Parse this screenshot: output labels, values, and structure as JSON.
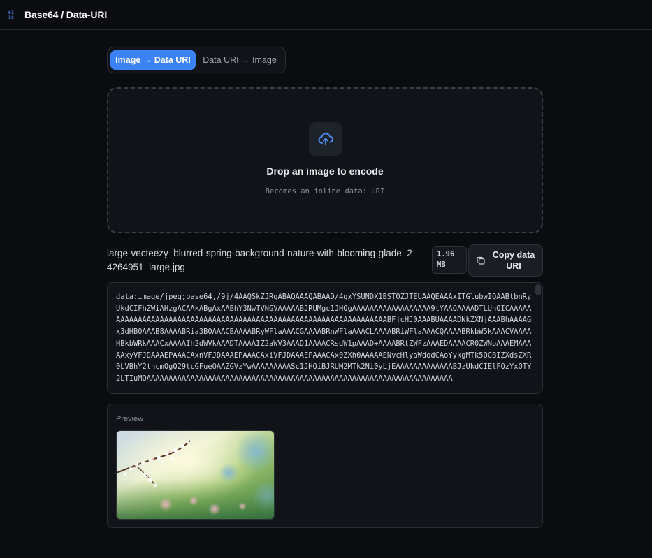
{
  "app": {
    "title": "Base64 / Data-URI",
    "icon": "binary-icon"
  },
  "tabs": [
    {
      "label": "Image → Data URI",
      "active": true
    },
    {
      "label": "Data URI → Image",
      "active": false
    }
  ],
  "dropzone": {
    "icon": "upload-cloud-icon",
    "title": "Drop an image to encode",
    "subtitle": "Becomes an inline data: URI"
  },
  "file": {
    "name": "large-vecteezy_blurred-spring-background-nature-with-blooming-glade_24264951_large.jpg",
    "size": "1.96 MB"
  },
  "copy_button": {
    "label": "Copy data URI",
    "icon": "copy-icon"
  },
  "output": {
    "text": "data:image/jpeg;base64,/9j/4AAQSkZJRgABAQAAAQABAAD/4gxYSUNDX1BST0ZJTEUAAQEAAAxITGlubwIQAABtbnRyUkdCIFhZWiAHzgACAAkABgAxAABhY3NwTVNGVAAAAABJRUMgc1JHQgAAAAAAAAAAAAAAAAAA9tYAAQAAAADTLUhQICAAAAAAAAAAAAAAAAAAAAAAAAAAAAAAAAAAAAAAAAAAAAAAAAAAAAAAAAAAAAAAAAAAABFjcHJ0AAABUAAAADNkZXNjAAABhAAAAGx3dHB0AAAB8AAAABRia3B0AAACBAAAABRyWFlaAAACGAAAABRnWFlaAAACLAAAABRiWFlaAAACQAAAABRkbW5kAAACVAAAAHBkbWRkAAACxAAAAIh2dWVkAAADTAAAAIZ2aWV3AAAD1AAAACRsdW1pAAAD+AAAABRtZWFzAAAEDAAAACR0ZWNoAAAEMAAAAAxyVFJDAAAEPAAACAxnVFJDAAAEPAAACAxiVFJDAAAEPAAACAx0ZXh0AAAAAENvcHlyaWdodCAoYykgMTk5OCBIZXdsZXR0LVBhY2thcmQgQ29tcGFueQAAZGVzYwAAAAAAAAASc1JHQiBJRUM2MTk2Ni0yLjEAAAAAAAAAAAAABJzUkdCIElFQzYxOTY2LTIuMQAAAAAAAAAAAAAAAAAAAAAAAAAAAAAAAAAAAAAAAAAAAAAAAAAAAAAAAAAAAAAAAAAAAAAA"
  },
  "preview": {
    "label": "Preview"
  },
  "colors": {
    "accent": "#3b82f6",
    "background": "#0b0c10",
    "surface": "#111318",
    "border": "#2a2e35"
  }
}
